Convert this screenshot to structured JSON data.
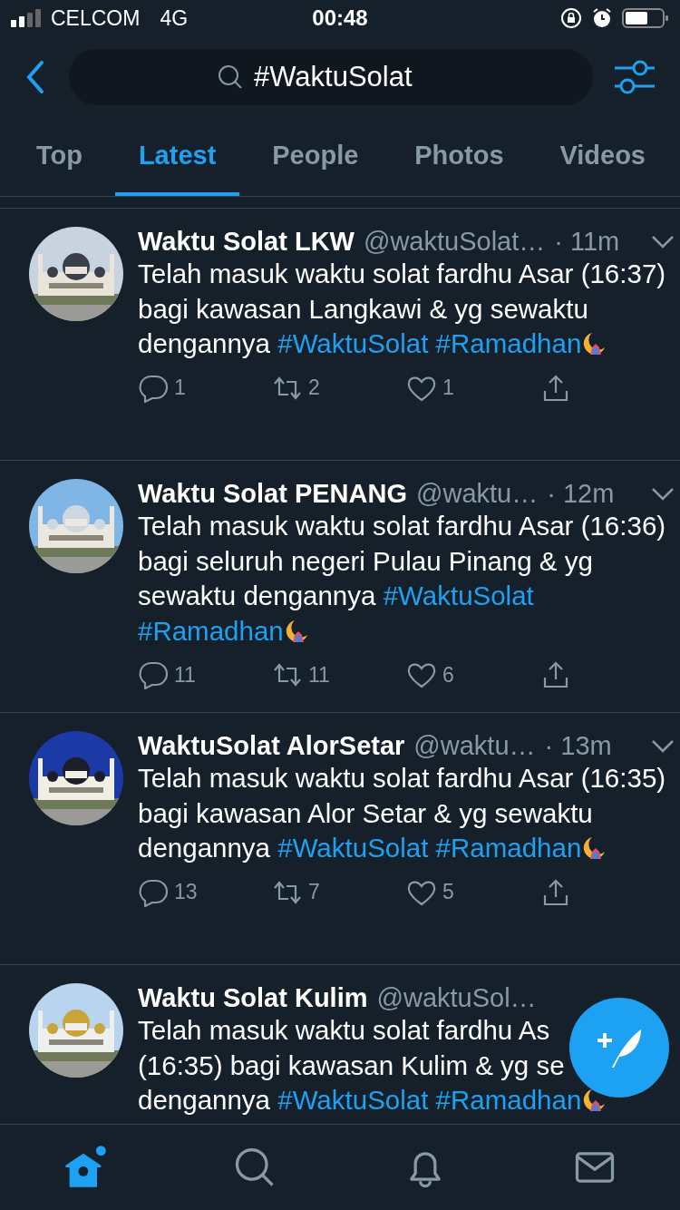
{
  "status_bar": {
    "carrier": "CELCOM",
    "network": "4G",
    "time": "00:48"
  },
  "search": {
    "value": "#WaktuSolat"
  },
  "tabs": [
    {
      "label": "Top",
      "selected": false
    },
    {
      "label": "Latest",
      "selected": true
    },
    {
      "label": "People",
      "selected": false
    },
    {
      "label": "Photos",
      "selected": false
    },
    {
      "label": "Videos",
      "selected": false
    }
  ],
  "tweets": [
    {
      "name": "Waktu Solat LKW",
      "handle": "@waktuSolat…",
      "time": "· 11m",
      "text": "Telah masuk waktu solat fardhu Asar (16:37) bagi kawasan Langkawi & yg sewaktu dengannya",
      "hashtags": [
        {
          "text": "#WaktuSolat",
          "hashflag": false
        },
        {
          "text": "#Ramadhan",
          "hashflag": true
        }
      ],
      "replies": "1",
      "retweets": "2",
      "likes": "1"
    },
    {
      "name": "Waktu Solat PENANG",
      "handle": "@waktu…",
      "time": "· 12m",
      "text": "Telah masuk waktu solat fardhu Asar (16:36) bagi seluruh negeri Pulau Pinang & yg sewaktu dengannya",
      "hashtags": [
        {
          "text": "#WaktuSolat",
          "hashflag": false
        },
        {
          "text": "#Ramadhan",
          "hashflag": true
        }
      ],
      "replies": "11",
      "retweets": "11",
      "likes": "6"
    },
    {
      "name": "WaktuSolat AlorSetar",
      "handle": "@waktu…",
      "time": "· 13m",
      "text": "Telah masuk waktu solat fardhu Asar (16:35) bagi kawasan Alor Setar & yg sewaktu dengannya",
      "hashtags": [
        {
          "text": "#WaktuSolat",
          "hashflag": false
        },
        {
          "text": "#Ramadhan",
          "hashflag": true
        }
      ],
      "replies": "13",
      "retweets": "7",
      "likes": "5"
    },
    {
      "name": "Waktu Solat Kulim",
      "handle": "@waktuSol…",
      "lines": [
        "Telah masuk waktu solat fardhu As",
        "(16:35) bagi kawasan Kulim & yg se",
        "dengannya"
      ],
      "hashtags": [
        {
          "text": "#WaktuSolat",
          "hashflag": false
        },
        {
          "text": "#Ramadhan",
          "hashflag": true
        }
      ]
    }
  ],
  "tab_bar": [
    {
      "selected": true
    },
    {
      "selected": false
    },
    {
      "selected": false
    },
    {
      "selected": false
    }
  ]
}
